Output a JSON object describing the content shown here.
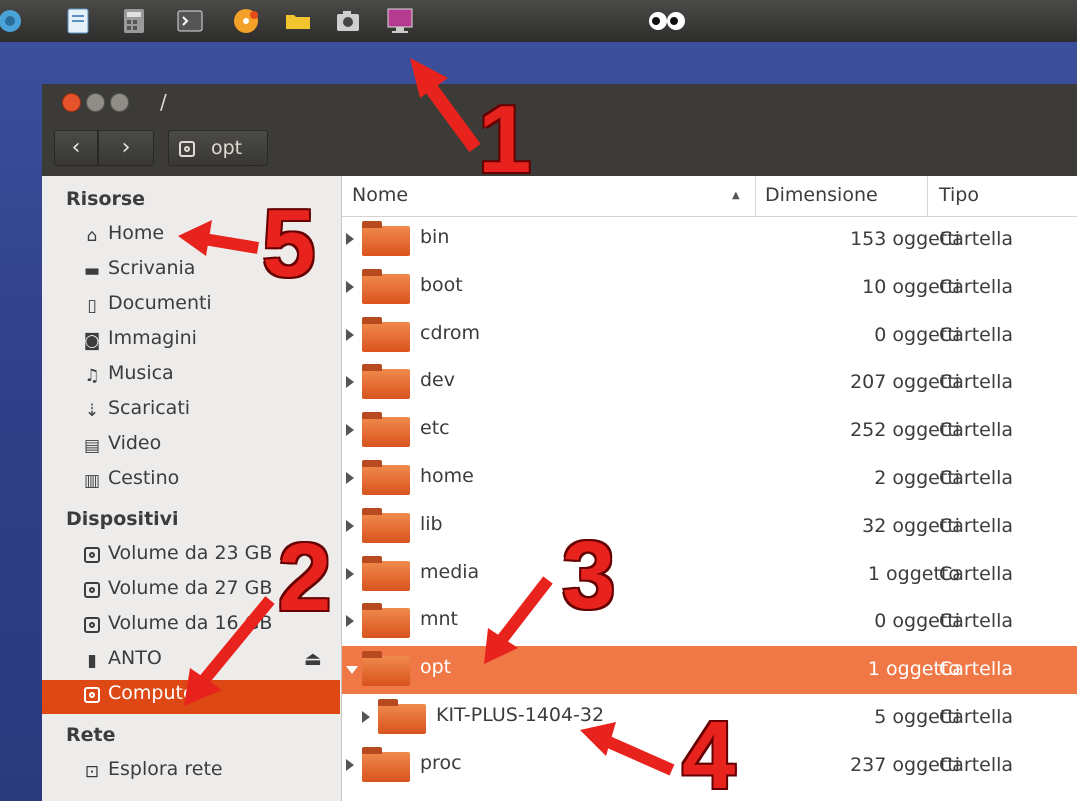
{
  "window": {
    "title": "/",
    "path_button": "opt"
  },
  "sidebar": {
    "sections": [
      {
        "title": "Risorse",
        "items": [
          {
            "label": "Home",
            "icon": "home-icon"
          },
          {
            "label": "Scrivania",
            "icon": "desktop-folder-icon"
          },
          {
            "label": "Documenti",
            "icon": "document-icon"
          },
          {
            "label": "Immagini",
            "icon": "camera-icon"
          },
          {
            "label": "Musica",
            "icon": "music-icon"
          },
          {
            "label": "Scaricati",
            "icon": "download-icon"
          },
          {
            "label": "Video",
            "icon": "film-icon"
          },
          {
            "label": "Cestino",
            "icon": "trash-icon"
          }
        ]
      },
      {
        "title": "Dispositivi",
        "items": [
          {
            "label": "Volume da 23 GB",
            "icon": "drive-icon"
          },
          {
            "label": "Volume da 27 GB",
            "icon": "drive-icon"
          },
          {
            "label": "Volume da 16 GB",
            "icon": "drive-icon"
          },
          {
            "label": "ANTO",
            "icon": "usb-icon"
          },
          {
            "label": "Computer",
            "icon": "drive-icon",
            "selected": true
          }
        ]
      },
      {
        "title": "Rete",
        "items": [
          {
            "label": "Esplora rete",
            "icon": "network-icon"
          }
        ]
      }
    ]
  },
  "filelist": {
    "columns": [
      "Nome",
      "Dimensione",
      "Tipo"
    ],
    "rows": [
      {
        "name": "bin",
        "size": "153 oggetti",
        "type": "Cartella"
      },
      {
        "name": "boot",
        "size": "10 oggetti",
        "type": "Cartella"
      },
      {
        "name": "cdrom",
        "size": "0 oggetti",
        "type": "Cartella"
      },
      {
        "name": "dev",
        "size": "207 oggetti",
        "type": "Cartella"
      },
      {
        "name": "etc",
        "size": "252 oggetti",
        "type": "Cartella"
      },
      {
        "name": "home",
        "size": "2 oggetti",
        "type": "Cartella"
      },
      {
        "name": "lib",
        "size": "32 oggetti",
        "type": "Cartella"
      },
      {
        "name": "media",
        "size": "1 oggetto",
        "type": "Cartella"
      },
      {
        "name": "mnt",
        "size": "0 oggetti",
        "type": "Cartella"
      },
      {
        "name": "opt",
        "size": "1 oggetto",
        "type": "Cartella",
        "selected": true,
        "expanded": true
      },
      {
        "name": "KIT-PLUS-1404-32",
        "size": "5 oggetti",
        "type": "Cartella",
        "child": true
      },
      {
        "name": "proc",
        "size": "237 oggetti",
        "type": "Cartella"
      }
    ]
  },
  "annotations": [
    "1",
    "2",
    "3",
    "4",
    "5"
  ],
  "colors": {
    "selection": "#dd4814",
    "selected_row": "#f07746",
    "annotation": "#e8231d",
    "titlebar": "#3c3b37"
  }
}
